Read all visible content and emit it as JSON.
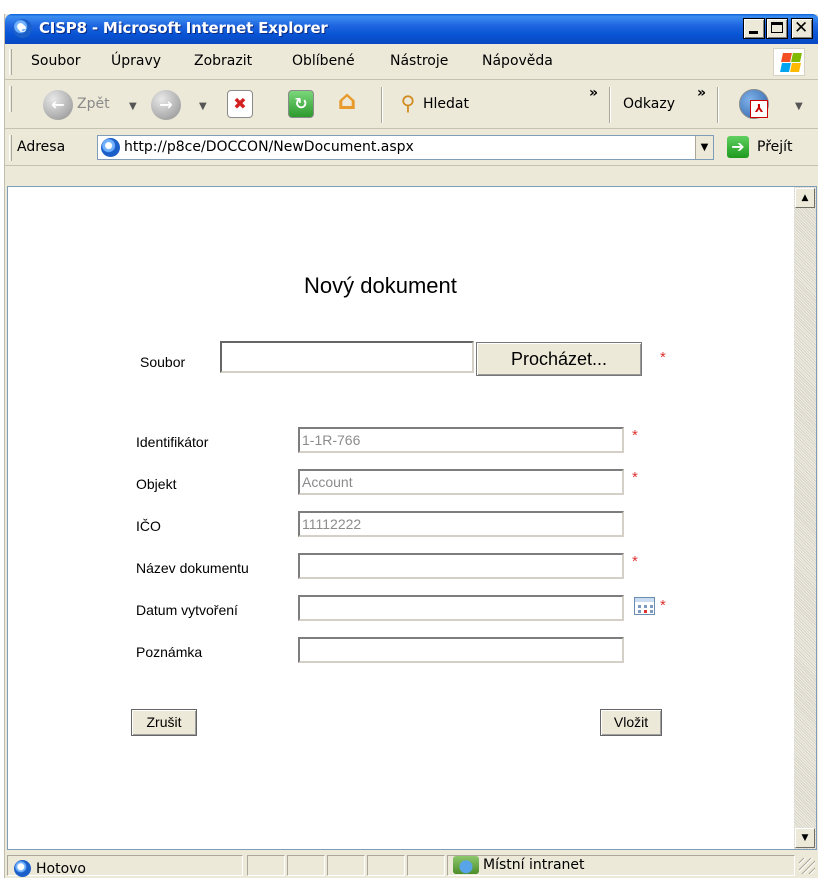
{
  "window": {
    "title": "CISP8 - Microsoft Internet Explorer",
    "caption_buttons": [
      "minimize",
      "maximize",
      "close"
    ]
  },
  "menu": {
    "items": [
      "Soubor",
      "Úpravy",
      "Zobrazit",
      "Oblíbené",
      "Nástroje",
      "Nápověda"
    ]
  },
  "toolbar": {
    "back_label": "Zpět",
    "search_label": "Hledat",
    "links_label": "Odkazy",
    "chevron": "»",
    "back_icon": "back-arrow-icon",
    "forward_icon": "forward-arrow-icon",
    "stop_icon": "stop-icon",
    "refresh_icon": "refresh-icon",
    "home_icon": "home-icon",
    "search_icon": "magnifier-icon"
  },
  "address": {
    "label": "Adresa",
    "url": "http://p8ce/DOCCON/NewDocument.aspx",
    "go_label": "Přejít"
  },
  "form": {
    "title": "Nový dokument",
    "file": {
      "label": "Soubor",
      "value": "",
      "browse_label": "Procházet..."
    },
    "required_mark": "*",
    "fields": {
      "identifier": {
        "label": "Identifikátor",
        "value": "1-1R-766",
        "required": true
      },
      "object": {
        "label": "Objekt",
        "value": "Account",
        "required": true
      },
      "ico": {
        "label": "IČO",
        "value": "11112222",
        "required": false
      },
      "doc_name": {
        "label": "Název dokumentu",
        "value": "",
        "required": true
      },
      "created": {
        "label": "Datum vytvoření",
        "value": "",
        "required": true
      },
      "note": {
        "label": "Poznámka",
        "value": "",
        "required": false
      }
    },
    "cancel_label": "Zrušit",
    "insert_label": "Vložit"
  },
  "status": {
    "text": "Hotovo",
    "zone": "Místní intranet"
  },
  "colors": {
    "titlebar": "#0a5fd8",
    "chrome": "#ece9d8",
    "required": "#dd3333",
    "field_text": "#8c8c8c"
  }
}
